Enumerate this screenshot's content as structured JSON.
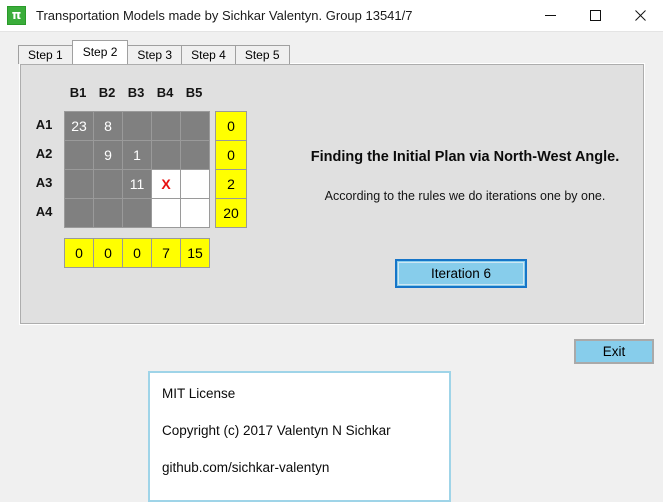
{
  "window": {
    "title": "Transportation Models made by Sichkar Valentyn. Group 13541/7",
    "icon_name": "tkinter-app-icon",
    "icon_glyph": "π",
    "controls": {
      "minimize_label": "minimize-icon",
      "maximize_label": "maximize-icon",
      "close_label": "close-icon"
    }
  },
  "tabs": [
    {
      "label": "Step 1",
      "active": false
    },
    {
      "label": "Step 2",
      "active": true
    },
    {
      "label": "Step 3",
      "active": false
    },
    {
      "label": "Step 4",
      "active": false
    },
    {
      "label": "Step 5",
      "active": false
    }
  ],
  "matrix": {
    "column_headers": [
      "B1",
      "B2",
      "B3",
      "B4",
      "B5"
    ],
    "row_labels": [
      "A1",
      "A2",
      "A3",
      "A4"
    ],
    "cells": [
      [
        {
          "value": "23",
          "state": "filled"
        },
        {
          "value": "8",
          "state": "filled"
        },
        {
          "value": "",
          "state": "filled"
        },
        {
          "value": "",
          "state": "filled"
        },
        {
          "value": "",
          "state": "filled"
        }
      ],
      [
        {
          "value": "",
          "state": "filled"
        },
        {
          "value": "9",
          "state": "filled"
        },
        {
          "value": "1",
          "state": "filled"
        },
        {
          "value": "",
          "state": "filled"
        },
        {
          "value": "",
          "state": "filled"
        }
      ],
      [
        {
          "value": "",
          "state": "filled"
        },
        {
          "value": "",
          "state": "filled"
        },
        {
          "value": "11",
          "state": "filled"
        },
        {
          "value": "X",
          "state": "crossed"
        },
        {
          "value": "",
          "state": "empty"
        }
      ],
      [
        {
          "value": "",
          "state": "filled"
        },
        {
          "value": "",
          "state": "filled"
        },
        {
          "value": "",
          "state": "filled"
        },
        {
          "value": "",
          "state": "empty"
        },
        {
          "value": "",
          "state": "empty"
        }
      ]
    ],
    "supply": [
      "0",
      "0",
      "2",
      "20"
    ],
    "demand": [
      "0",
      "0",
      "0",
      "7",
      "15"
    ]
  },
  "content": {
    "headline": "Finding the Initial Plan via North-West Angle.",
    "subtext": "According to the rules we do iterations one by one.",
    "iteration_button_label": "Iteration 6"
  },
  "exit_button": {
    "label": "Exit"
  },
  "license": {
    "line1": "MIT License",
    "line2": "Copyright (c) 2017 Valentyn N Sichkar",
    "line3": "github.com/sichkar-valentyn"
  },
  "colors": {
    "yellow": "#ffff00",
    "cell_filled": "#808080",
    "cell_empty": "#ffffff",
    "x_mark": "#e81010",
    "button_blue": "#87cdeb",
    "focus_blue": "#1675c8",
    "license_border": "#9fd4e8",
    "window_bg": "#f0f0f0",
    "panel_bg": "#e0e0e0"
  }
}
